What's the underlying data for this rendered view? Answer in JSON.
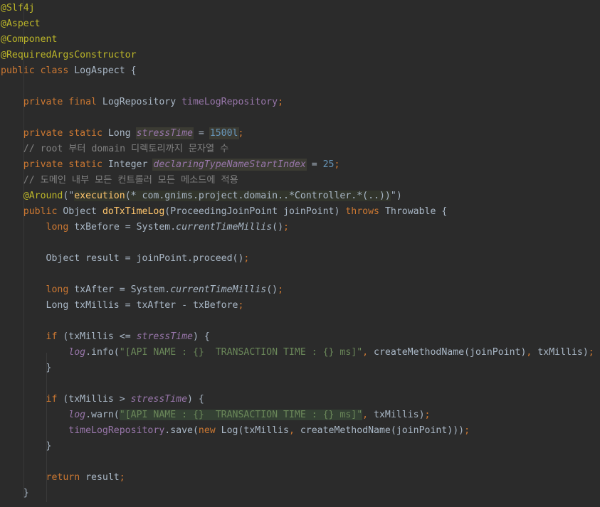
{
  "editor": {
    "language": "java",
    "colors": {
      "background": "#2b2b2b",
      "default": "#a9b7c6",
      "keyword": "#cc7832",
      "annotation": "#bbb529",
      "string": "#6a8759",
      "number": "#6897bb",
      "comment": "#808080",
      "field": "#9876aa",
      "method_declaration": "#ffc66d"
    },
    "lines": [
      [
        {
          "t": "@Slf4j",
          "c": "ann"
        }
      ],
      [
        {
          "t": "@Aspect",
          "c": "ann"
        }
      ],
      [
        {
          "t": "@Component",
          "c": "ann"
        }
      ],
      [
        {
          "t": "@RequiredArgsConstructor",
          "c": "ann"
        }
      ],
      [
        {
          "t": "public class",
          "c": "kw"
        },
        {
          "t": " LogAspect {"
        }
      ],
      [],
      [
        {
          "t": "    "
        },
        {
          "t": "private final",
          "c": "kw"
        },
        {
          "t": " LogRepository "
        },
        {
          "t": "timeLogRepository",
          "c": "field"
        },
        {
          "t": ";",
          "c": "kw"
        }
      ],
      [],
      [
        {
          "t": "    "
        },
        {
          "t": "private static",
          "c": "kw"
        },
        {
          "t": " Long "
        },
        {
          "t": "stressTime",
          "c": "sfield hl"
        },
        {
          "t": " = "
        },
        {
          "t": "1500l",
          "c": "num hl"
        },
        {
          "t": ";",
          "c": "kw"
        }
      ],
      [
        {
          "t": "    // root 부터 domain 디렉토리까지 문자열 수",
          "c": "cmt"
        }
      ],
      [
        {
          "t": "    "
        },
        {
          "t": "private static",
          "c": "kw"
        },
        {
          "t": " Integer "
        },
        {
          "t": "declaringTypeNameStartIndex",
          "c": "sfield hl"
        },
        {
          "t": " = "
        },
        {
          "t": "25",
          "c": "num"
        },
        {
          "t": ";",
          "c": "kw"
        }
      ],
      [
        {
          "t": "    // 도메인 내부 모든 컨트롤러 모든 메소드에 적용",
          "c": "cmt"
        }
      ],
      [
        {
          "t": "    "
        },
        {
          "t": "@Around",
          "c": "ann"
        },
        {
          "t": "(\""
        },
        {
          "t": "execution",
          "c": "meth hlg"
        },
        {
          "t": "(* com.gnims.project.domain..*Controller.*(..))",
          "c": "hlg"
        },
        {
          "t": "\")"
        }
      ],
      [
        {
          "t": "    "
        },
        {
          "t": "public",
          "c": "kw"
        },
        {
          "t": " Object "
        },
        {
          "t": "doTxTimeLog",
          "c": "meth"
        },
        {
          "t": "(ProceedingJoinPoint joinPoint) "
        },
        {
          "t": "throws",
          "c": "kw"
        },
        {
          "t": " Throwable {"
        }
      ],
      [
        {
          "t": "        "
        },
        {
          "t": "long",
          "c": "kw"
        },
        {
          "t": " txBefore = System."
        },
        {
          "t": "currentTimeMillis",
          "c": "smeth"
        },
        {
          "t": "()"
        },
        {
          "t": ";",
          "c": "kw"
        }
      ],
      [],
      [
        {
          "t": "        Object result = joinPoint.proceed()"
        },
        {
          "t": ";",
          "c": "kw"
        }
      ],
      [],
      [
        {
          "t": "        "
        },
        {
          "t": "long",
          "c": "kw"
        },
        {
          "t": " txAfter = System."
        },
        {
          "t": "currentTimeMillis",
          "c": "smeth"
        },
        {
          "t": "()"
        },
        {
          "t": ";",
          "c": "kw"
        }
      ],
      [
        {
          "t": "        Long txMillis = txAfter - txBefore"
        },
        {
          "t": ";",
          "c": "kw"
        }
      ],
      [],
      [
        {
          "t": "        "
        },
        {
          "t": "if",
          "c": "kw"
        },
        {
          "t": " (txMillis <= "
        },
        {
          "t": "stressTime",
          "c": "sfield"
        },
        {
          "t": ") {"
        }
      ],
      [
        {
          "t": "            "
        },
        {
          "t": "log",
          "c": "sfield"
        },
        {
          "t": ".info("
        },
        {
          "t": "\"[API NAME : {}  TRANSACTION TIME : {} ms]\"",
          "c": "str"
        },
        {
          "t": ", ",
          "c": "kw"
        },
        {
          "t": "createMethodName(joinPoint)"
        },
        {
          "t": ", ",
          "c": "kw"
        },
        {
          "t": "txMillis)"
        },
        {
          "t": ";",
          "c": "kw"
        }
      ],
      [
        {
          "t": "        }"
        }
      ],
      [],
      [
        {
          "t": "        "
        },
        {
          "t": "if",
          "c": "kw"
        },
        {
          "t": " (txMillis > "
        },
        {
          "t": "stressTime",
          "c": "sfield"
        },
        {
          "t": ") {"
        }
      ],
      [
        {
          "t": "            "
        },
        {
          "t": "log",
          "c": "sfield"
        },
        {
          "t": ".warn("
        },
        {
          "t": "\"[API NAME : {}  TRANSACTION TIME : {} ms]\"",
          "c": "str hlstr"
        },
        {
          "t": ", ",
          "c": "kw"
        },
        {
          "t": "txMillis)"
        },
        {
          "t": ";",
          "c": "kw"
        }
      ],
      [
        {
          "t": "            "
        },
        {
          "t": "timeLogRepository",
          "c": "field"
        },
        {
          "t": ".save("
        },
        {
          "t": "new",
          "c": "kw"
        },
        {
          "t": " Log(txMillis"
        },
        {
          "t": ", ",
          "c": "kw"
        },
        {
          "t": "createMethodName(joinPoint)))"
        },
        {
          "t": ";",
          "c": "kw"
        }
      ],
      [
        {
          "t": "        }"
        }
      ],
      [],
      [
        {
          "t": "        "
        },
        {
          "t": "return",
          "c": "kw"
        },
        {
          "t": " result"
        },
        {
          "t": ";",
          "c": "kw"
        }
      ],
      [
        {
          "t": "    }"
        }
      ]
    ]
  }
}
